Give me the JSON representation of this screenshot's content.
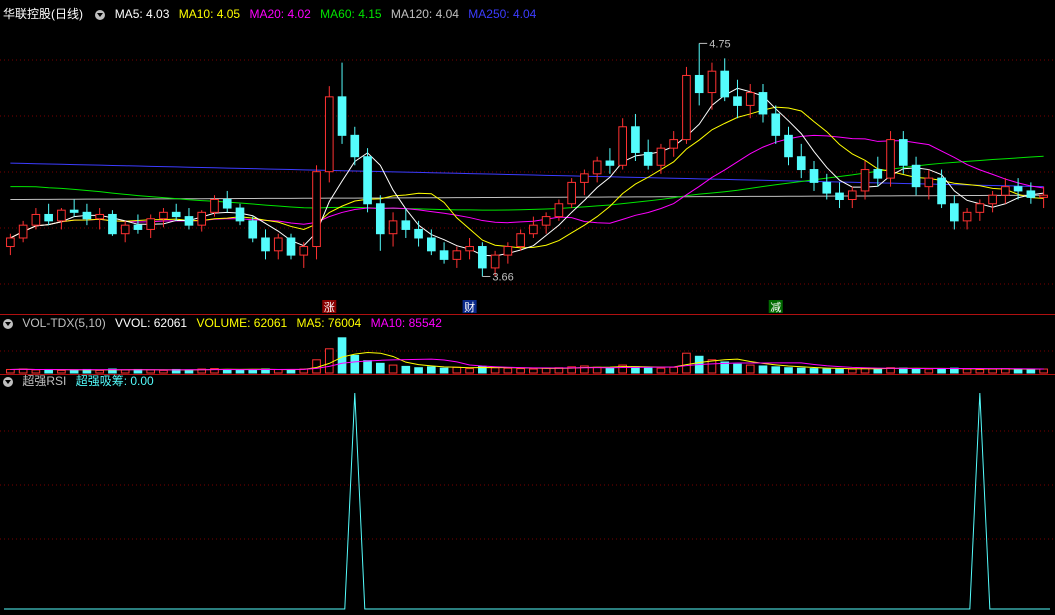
{
  "main_header": {
    "title": "华联控股(日线)",
    "ma5": "MA5: 4.03",
    "ma10": "MA10: 4.05",
    "ma20": "MA20: 4.02",
    "ma60": "MA60: 4.15",
    "ma120": "MA120: 4.04",
    "ma250": "MA250: 4.04"
  },
  "vol_header": {
    "title": "VOL-TDX(5,10)",
    "vvol": "VVOL: 62061",
    "volume": "VOLUME: 62061",
    "ma5": "MA5: 76004",
    "ma10": "MA10: 85542"
  },
  "rsi_header": {
    "title": "超强RSI",
    "value": "超强吸筹: 0.00"
  },
  "annotations": {
    "high_label": "4.75",
    "low_label": "3.66",
    "event_zhang": "涨",
    "event_cai": "财",
    "event_jian": "减"
  },
  "colors": {
    "up": "#ff3232",
    "down": "#54fcfc",
    "ma5": "#ffffff",
    "ma10": "#ffff00",
    "ma20": "#ff00ff",
    "ma60": "#00e600",
    "ma120": "#c0c0c0",
    "ma250": "#3c3cff",
    "grid": "#7a0000",
    "rsi": "#54fcfc"
  },
  "chart_data": {
    "type": "candlestick",
    "y_range": [
      3.55,
      4.85
    ],
    "high_annotation": 4.75,
    "low_annotation": 3.66,
    "ohlc": [
      [
        3.8,
        3.86,
        3.76,
        3.84
      ],
      [
        3.84,
        3.92,
        3.82,
        3.9
      ],
      [
        3.9,
        3.98,
        3.88,
        3.95
      ],
      [
        3.95,
        4.0,
        3.9,
        3.92
      ],
      [
        3.92,
        3.98,
        3.88,
        3.97
      ],
      [
        3.97,
        4.02,
        3.94,
        3.96
      ],
      [
        3.96,
        4.0,
        3.9,
        3.93
      ],
      [
        3.93,
        3.98,
        3.88,
        3.95
      ],
      [
        3.95,
        3.97,
        3.85,
        3.86
      ],
      [
        3.86,
        3.92,
        3.82,
        3.9
      ],
      [
        3.9,
        3.95,
        3.86,
        3.88
      ],
      [
        3.88,
        3.95,
        3.84,
        3.93
      ],
      [
        3.93,
        3.98,
        3.89,
        3.96
      ],
      [
        3.96,
        4.0,
        3.92,
        3.94
      ],
      [
        3.94,
        3.98,
        3.88,
        3.9
      ],
      [
        3.9,
        3.97,
        3.87,
        3.96
      ],
      [
        3.96,
        4.04,
        3.94,
        4.02
      ],
      [
        4.02,
        4.06,
        3.96,
        3.98
      ],
      [
        3.98,
        4.0,
        3.9,
        3.92
      ],
      [
        3.92,
        3.94,
        3.82,
        3.84
      ],
      [
        3.84,
        3.88,
        3.74,
        3.78
      ],
      [
        3.78,
        3.86,
        3.74,
        3.84
      ],
      [
        3.84,
        3.86,
        3.74,
        3.76
      ],
      [
        3.76,
        3.82,
        3.7,
        3.8
      ],
      [
        3.8,
        4.18,
        3.74,
        4.15
      ],
      [
        4.15,
        4.55,
        4.1,
        4.5
      ],
      [
        4.5,
        4.66,
        4.28,
        4.32
      ],
      [
        4.32,
        4.36,
        4.18,
        4.22
      ],
      [
        4.22,
        4.26,
        3.96,
        4.0
      ],
      [
        4.0,
        4.04,
        3.78,
        3.86
      ],
      [
        3.86,
        3.96,
        3.8,
        3.92
      ],
      [
        3.92,
        3.98,
        3.84,
        3.88
      ],
      [
        3.88,
        3.92,
        3.8,
        3.84
      ],
      [
        3.84,
        3.88,
        3.76,
        3.78
      ],
      [
        3.78,
        3.82,
        3.72,
        3.74
      ],
      [
        3.74,
        3.8,
        3.7,
        3.78
      ],
      [
        3.78,
        3.84,
        3.74,
        3.8
      ],
      [
        3.8,
        3.82,
        3.66,
        3.7
      ],
      [
        3.7,
        3.78,
        3.66,
        3.76
      ],
      [
        3.76,
        3.82,
        3.72,
        3.8
      ],
      [
        3.8,
        3.88,
        3.78,
        3.86
      ],
      [
        3.86,
        3.94,
        3.84,
        3.9
      ],
      [
        3.9,
        3.96,
        3.86,
        3.94
      ],
      [
        3.94,
        4.02,
        3.92,
        4.0
      ],
      [
        4.0,
        4.12,
        3.98,
        4.1
      ],
      [
        4.1,
        4.16,
        4.04,
        4.14
      ],
      [
        4.14,
        4.22,
        4.1,
        4.2
      ],
      [
        4.2,
        4.26,
        4.14,
        4.18
      ],
      [
        4.18,
        4.4,
        4.16,
        4.36
      ],
      [
        4.36,
        4.42,
        4.2,
        4.24
      ],
      [
        4.24,
        4.3,
        4.16,
        4.18
      ],
      [
        4.18,
        4.28,
        4.14,
        4.26
      ],
      [
        4.26,
        4.34,
        4.22,
        4.3
      ],
      [
        4.3,
        4.64,
        4.28,
        4.6
      ],
      [
        4.6,
        4.75,
        4.46,
        4.52
      ],
      [
        4.52,
        4.66,
        4.44,
        4.62
      ],
      [
        4.62,
        4.68,
        4.48,
        4.5
      ],
      [
        4.5,
        4.58,
        4.4,
        4.46
      ],
      [
        4.46,
        4.56,
        4.4,
        4.52
      ],
      [
        4.52,
        4.56,
        4.38,
        4.42
      ],
      [
        4.42,
        4.46,
        4.28,
        4.32
      ],
      [
        4.32,
        4.36,
        4.18,
        4.22
      ],
      [
        4.22,
        4.28,
        4.12,
        4.16
      ],
      [
        4.16,
        4.2,
        4.06,
        4.1
      ],
      [
        4.1,
        4.14,
        4.02,
        4.05
      ],
      [
        4.05,
        4.1,
        3.98,
        4.02
      ],
      [
        4.02,
        4.08,
        3.98,
        4.06
      ],
      [
        4.06,
        4.2,
        4.02,
        4.16
      ],
      [
        4.16,
        4.22,
        4.08,
        4.12
      ],
      [
        4.12,
        4.34,
        4.08,
        4.3
      ],
      [
        4.3,
        4.34,
        4.14,
        4.18
      ],
      [
        4.18,
        4.22,
        4.04,
        4.08
      ],
      [
        4.08,
        4.16,
        4.02,
        4.12
      ],
      [
        4.12,
        4.16,
        3.98,
        4.0
      ],
      [
        4.0,
        4.04,
        3.88,
        3.92
      ],
      [
        3.92,
        3.98,
        3.88,
        3.96
      ],
      [
        3.96,
        4.02,
        3.92,
        4.0
      ],
      [
        4.0,
        4.06,
        3.96,
        4.04
      ],
      [
        4.04,
        4.12,
        4.0,
        4.08
      ],
      [
        4.08,
        4.12,
        4.02,
        4.06
      ],
      [
        4.06,
        4.1,
        4.0,
        4.03
      ],
      [
        4.03,
        4.08,
        3.98,
        4.04
      ]
    ],
    "volume_y_range": [
      0,
      100
    ],
    "volume": [
      8,
      9,
      7,
      8,
      6,
      7,
      8,
      6,
      9,
      7,
      8,
      7,
      6,
      8,
      7,
      9,
      10,
      8,
      7,
      8,
      9,
      8,
      7,
      9,
      30,
      55,
      80,
      40,
      28,
      22,
      18,
      15,
      12,
      14,
      11,
      13,
      10,
      15,
      12,
      11,
      10,
      9,
      11,
      12,
      14,
      16,
      13,
      12,
      18,
      14,
      12,
      11,
      13,
      45,
      38,
      30,
      25,
      20,
      18,
      16,
      14,
      12,
      11,
      10,
      9,
      10,
      9,
      11,
      10,
      12,
      11,
      10,
      9,
      10,
      11,
      9,
      8,
      9,
      10,
      9,
      8,
      9
    ],
    "rsi_y_range": [
      0,
      100
    ],
    "rsi_spikes_at_index": [
      27,
      76
    ]
  }
}
